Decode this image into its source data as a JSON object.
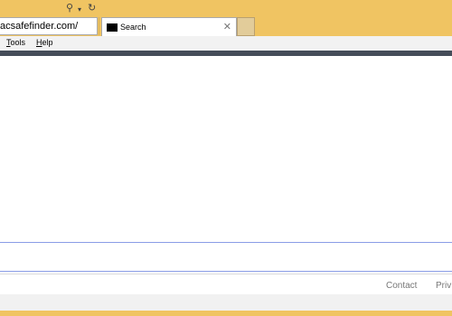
{
  "browser": {
    "address": {
      "url": "acsafefinder.com/",
      "search_icon": "search-icon",
      "dropdown_icon": "chevron-down-icon",
      "refresh_icon": "refresh-icon"
    },
    "tab": {
      "title": "Search",
      "close_glyph": "✕"
    },
    "menu": {
      "tools_letter": "T",
      "tools_rest": "ools",
      "help_letter": "H",
      "help_rest": "elp"
    }
  },
  "page": {
    "footer": {
      "contact": "Contact",
      "privacy_partial": "Priv"
    }
  },
  "colors": {
    "frame": "#f0c462",
    "accent_bar": "#454d59",
    "search_border": "#8a9de6"
  }
}
